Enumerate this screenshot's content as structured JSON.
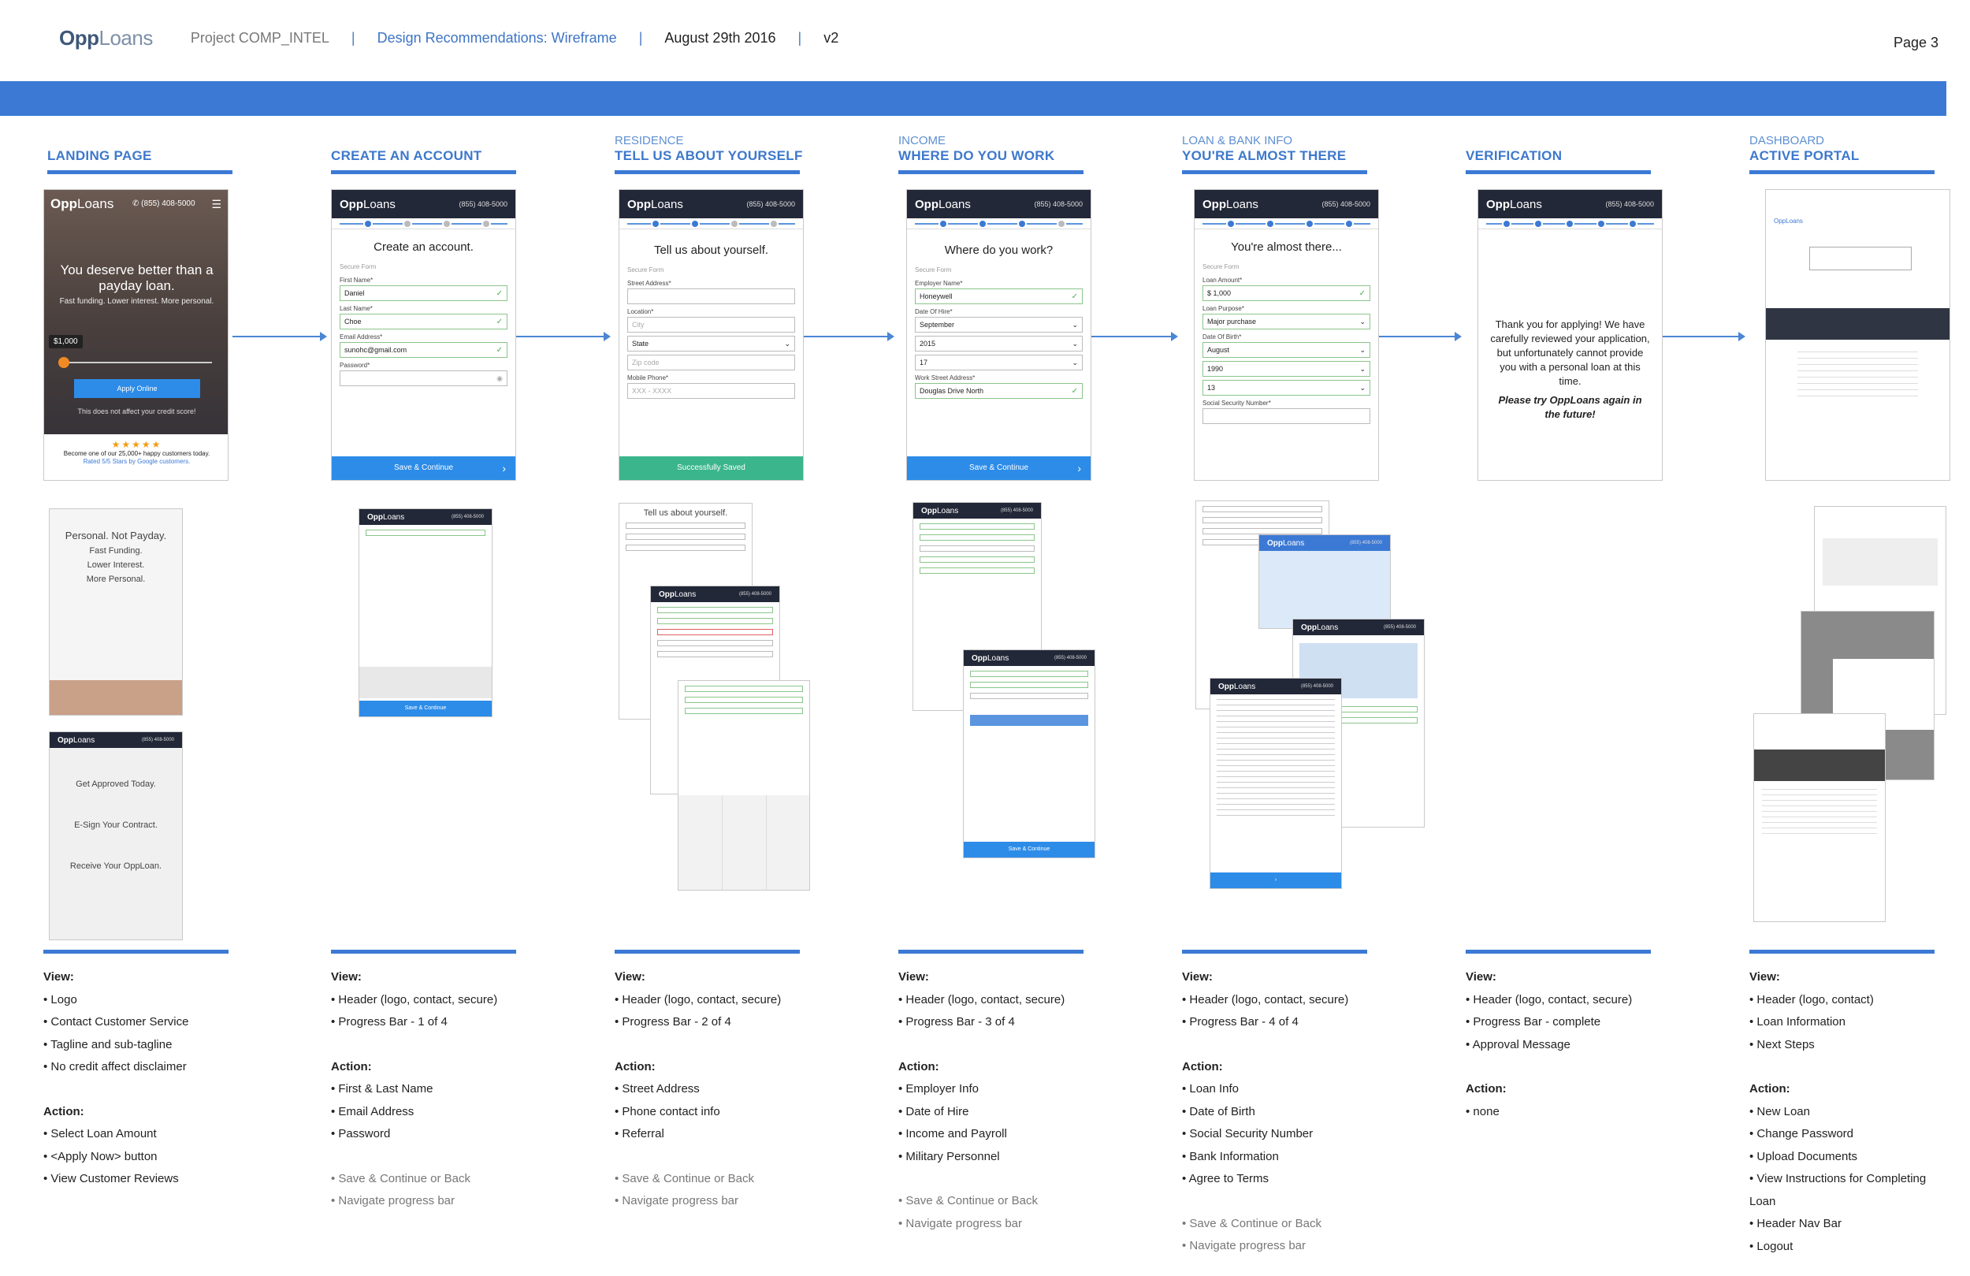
{
  "header": {
    "logo_bold": "Opp",
    "logo_rest": "Loans",
    "project": "Project COMP_INTEL",
    "recommendations": "Design Recommendations: Wireframe",
    "date": "August 29th  2016",
    "version": "v2",
    "separator": "|",
    "page": "Page 3"
  },
  "colors": {
    "accent": "#3b79d5",
    "header_dark": "#232838",
    "cta": "#2d8ce8",
    "success": "#3bb58b"
  },
  "columns": [
    {
      "sup": "",
      "title": "LANDING PAGE"
    },
    {
      "sup": "",
      "title": "CREATE AN ACCOUNT"
    },
    {
      "sup": "RESIDENCE",
      "title": "TELL US ABOUT YOURSELF"
    },
    {
      "sup": "INCOME",
      "title": "WHERE DO YOU WORK"
    },
    {
      "sup": "LOAN & BANK INFO",
      "title": "YOU'RE ALMOST THERE"
    },
    {
      "sup": "",
      "title": "VERIFICATION"
    },
    {
      "sup": "DASHBOARD",
      "title": "ACTIVE PORTAL"
    }
  ],
  "mock": {
    "logo_bold": "Opp",
    "logo_rest": "Loans",
    "phone": "(855) 408-5000",
    "secure": "Secure Form",
    "save": "Save & Continue",
    "saved": "Successfully Saved",
    "landing": {
      "tagline": "You deserve better than a payday loan.",
      "sub": "Fast funding. Lower interest. More personal.",
      "amount": "$1,000",
      "apply": "Apply Online",
      "disclaimer": "This does not affect your credit score!",
      "stars": "★★★★★",
      "reviews": "Become one of our 25,000+ happy customers today.",
      "rated": "Rated 5/5 Stars by Google customers."
    },
    "create": {
      "title": "Create an account.",
      "fields": [
        {
          "label": "First Name*",
          "value": "Daniel"
        },
        {
          "label": "Last Name*",
          "value": "Choe"
        },
        {
          "label": "Email Address*",
          "value": "sunohc@gmail.com"
        },
        {
          "label": "Password*",
          "value": ""
        }
      ]
    },
    "residence": {
      "title": "Tell us about yourself.",
      "fields": [
        {
          "label": "Street Address*",
          "value": ""
        },
        {
          "label": "Location*",
          "value": "City"
        },
        {
          "label": "",
          "value": "State"
        },
        {
          "label": "",
          "value": "Zip code"
        },
        {
          "label": "Mobile Phone*",
          "value": "XXX - XXXX"
        }
      ]
    },
    "income": {
      "title": "Where do you work?",
      "fields": [
        {
          "label": "Employer Name*",
          "value": "Honeywell"
        },
        {
          "label": "Date Of Hire*",
          "value": "September"
        },
        {
          "label": "",
          "value": "2015"
        },
        {
          "label": "",
          "value": "17"
        },
        {
          "label": "Work Street Address*",
          "value": "Douglas Drive North"
        }
      ]
    },
    "loan": {
      "title": "You're almost there...",
      "fields": [
        {
          "label": "Loan Amount*",
          "value": "$ 1,000"
        },
        {
          "label": "Loan Purpose*",
          "value": "Major purchase"
        },
        {
          "label": "Date Of Birth*",
          "value": "August"
        },
        {
          "label": "",
          "value": "1990"
        },
        {
          "label": "",
          "value": "13"
        },
        {
          "label": "Social Security Number*",
          "value": ""
        }
      ]
    },
    "verification": {
      "message": "Thank you for applying! We have carefully reviewed your application, but unfortunately cannot provide you with a personal loan at this time.",
      "retry": "Please try OppLoans again in the future!"
    }
  },
  "secondary": {
    "landing_a": "Personal. Not Payday.",
    "landing_b_items": [
      "Fast Funding.",
      "Lower Interest.",
      "More Personal."
    ],
    "landing_c_items": [
      "Get Approved Today.",
      "E-Sign Your Contract.",
      "Receive Your OppLoan."
    ],
    "residence_title": "Tell us about yourself."
  },
  "notes": [
    {
      "view": [
        "Logo",
        "Contact Customer Service",
        "Tagline and sub-tagline",
        "No credit affect disclaimer"
      ],
      "action": [
        "Select Loan Amount",
        "<Apply Now> button",
        "View Customer Reviews"
      ],
      "nav": []
    },
    {
      "view": [
        "Header (logo, contact, secure)",
        "Progress Bar - 1 of 4"
      ],
      "action": [
        "First & Last Name",
        "Email Address",
        "Password"
      ],
      "nav": [
        "Save & Continue or Back",
        "Navigate progress bar"
      ]
    },
    {
      "view": [
        "Header (logo, contact, secure)",
        "Progress Bar - 2 of 4"
      ],
      "action": [
        "Street Address",
        "Phone contact info",
        "Referral"
      ],
      "nav": [
        "Save & Continue or Back",
        "Navigate progress bar"
      ]
    },
    {
      "view": [
        "Header (logo, contact, secure)",
        "Progress Bar - 3 of 4"
      ],
      "action": [
        "Employer Info",
        "Date of Hire",
        "Income and Payroll",
        "Military Personnel"
      ],
      "nav": [
        "Save & Continue or Back",
        "Navigate progress bar"
      ]
    },
    {
      "view": [
        "Header (logo, contact, secure)",
        "Progress Bar - 4 of 4"
      ],
      "action": [
        "Loan Info",
        "Date of Birth",
        "Social Security Number",
        "Bank Information",
        "Agree to Terms"
      ],
      "nav": [
        "Save & Continue or Back",
        "Navigate progress bar"
      ]
    },
    {
      "view": [
        "Header (logo, contact, secure)",
        "Progress Bar - complete",
        "Approval Message"
      ],
      "action": [
        "none"
      ],
      "nav": []
    },
    {
      "view": [
        "Header (logo, contact)",
        "Loan Information",
        "Next Steps"
      ],
      "action": [
        "New Loan",
        "Change Password",
        "Upload Documents",
        "View Instructions for Completing Loan",
        "Header Nav Bar",
        "Logout"
      ],
      "nav": []
    }
  ],
  "labels": {
    "view": "View:",
    "action": "Action:"
  }
}
